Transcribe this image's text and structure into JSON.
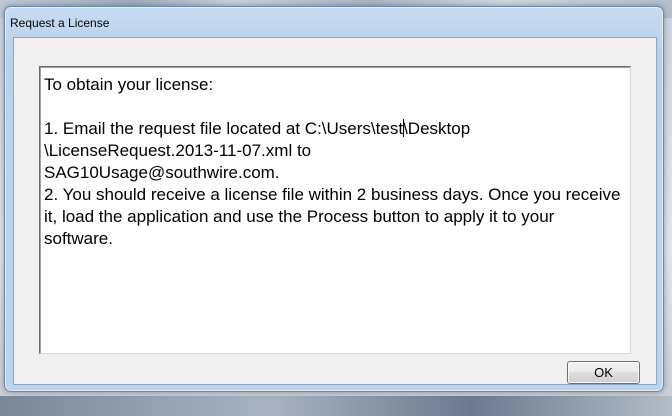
{
  "window": {
    "title": "Request a License"
  },
  "message": {
    "heading": "To obtain your license:",
    "step1_before_caret": "1. Email the request file located at C:\\Users\\test",
    "step1_after_caret": "\\Desktop",
    "step1_line2": "\\LicenseRequest.2013-11-07.xml to",
    "step1_line3": "SAG10Usage@southwire.com.",
    "step2": "2. You should receive a license file within 2 business days. Once you receive it, load the application and use the Process button to apply it to your software."
  },
  "buttons": {
    "ok_label": "OK"
  }
}
